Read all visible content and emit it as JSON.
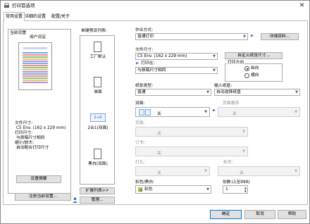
{
  "window": {
    "title": "打印首选项",
    "close_glyph": "✕"
  },
  "tabs": [
    {
      "label": "常用设置"
    },
    {
      "label": "详细的设置"
    },
    {
      "label": "配置/关于"
    }
  ],
  "left": {
    "current_title": "当前设置",
    "preview_caption": "用户设定",
    "summary": [
      "文件尺寸:",
      "C5 Env. (162 x 229 mm)",
      "打印尺寸:",
      "与原稿尺寸相同",
      "缩小/放大:",
      "自动配合打印尺寸"
    ],
    "summary_button": "设置摘要",
    "register_button": "注册当前设置..."
  },
  "favorites": {
    "title": "单键预设列表:",
    "items": [
      {
        "label": "工厂默认"
      },
      {
        "label": "单面"
      },
      {
        "label": "2合1(双面)",
        "badge": "1→2"
      },
      {
        "label": "黑白(双面)"
      }
    ],
    "expand_button": "扩展列表>>",
    "manage_button": "管理..."
  },
  "form": {
    "job_type": {
      "label": "作业方式:",
      "value": "普通打印",
      "details_button": "详细资料..."
    },
    "doc_size": {
      "label": "文件尺寸:",
      "value": "C5 Env. (162 x 229 mm)",
      "custom_button": "自定义纸张尺寸..."
    },
    "print_on": {
      "label": "打印在:",
      "value": "与原稿尺寸相同"
    },
    "orientation": {
      "label": "打印方向",
      "portrait": "纵向",
      "landscape": "横向",
      "selected": "portrait"
    },
    "paper_type": {
      "label": "纸张类型:",
      "value": "普通"
    },
    "input_tray": {
      "label": "输入纸盘:",
      "value": "自动选择纸盘"
    },
    "duplex": {
      "label": "双面:",
      "value": "关"
    },
    "booklet": {
      "label": "页面顺序:",
      "value": "关"
    },
    "layout": {
      "label": "页面:",
      "value": "关"
    },
    "staple": {
      "label": "订书:",
      "value": "关"
    },
    "punch": {
      "label": "打孔:",
      "value": "关"
    },
    "fold": {
      "label": "折页:",
      "value": "关"
    },
    "color": {
      "label": "彩色/黑白:",
      "value": "彩色"
    },
    "copies": {
      "label": "份数:(1至999)",
      "value": "1"
    }
  },
  "buttons": {
    "ok": "确定",
    "cancel": "取消",
    "help": "帮助"
  },
  "colors": {
    "accent": "#0078d7",
    "link": "#4a7fd0"
  }
}
